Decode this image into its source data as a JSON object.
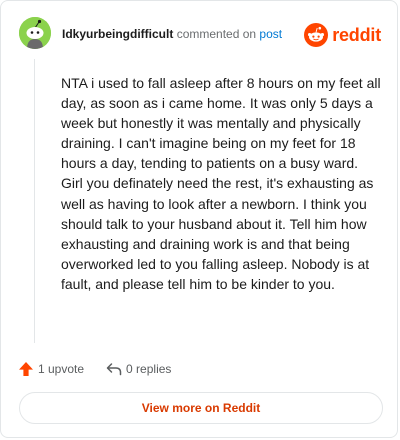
{
  "comment": {
    "username": "Idkyurbeingdifficult",
    "commented_on": "commented on",
    "post_link": "post",
    "body": "NTA i used to fall asleep after 8 hours on my feet all day, as soon as i came home. It was only 5 days a week but honestly it was mentally and physically draining. I can't imagine being on my feet for 18 hours a day, tending to patients on a busy ward. Girl you definately need the rest, it's exhausting as well as having to look after a newborn. I think you should talk to your husband about it. Tell him how exhausting and draining work is and that being overworked led to you falling asleep. Nobody is at fault, and please tell him to be kinder to you."
  },
  "brand": {
    "name": "reddit",
    "icon": "reddit-snoo-icon",
    "color": "#ff4500"
  },
  "actions": {
    "upvote_label": "1 upvote",
    "replies_label": "0 replies",
    "upvote_icon": "upvote-arrow-icon",
    "reply_icon": "reply-arrow-icon"
  },
  "footer": {
    "view_more_label": "View more on Reddit"
  },
  "colors": {
    "accent": "#d93a00",
    "link": "#0079d3",
    "avatar_bg": "#8bd24d"
  }
}
